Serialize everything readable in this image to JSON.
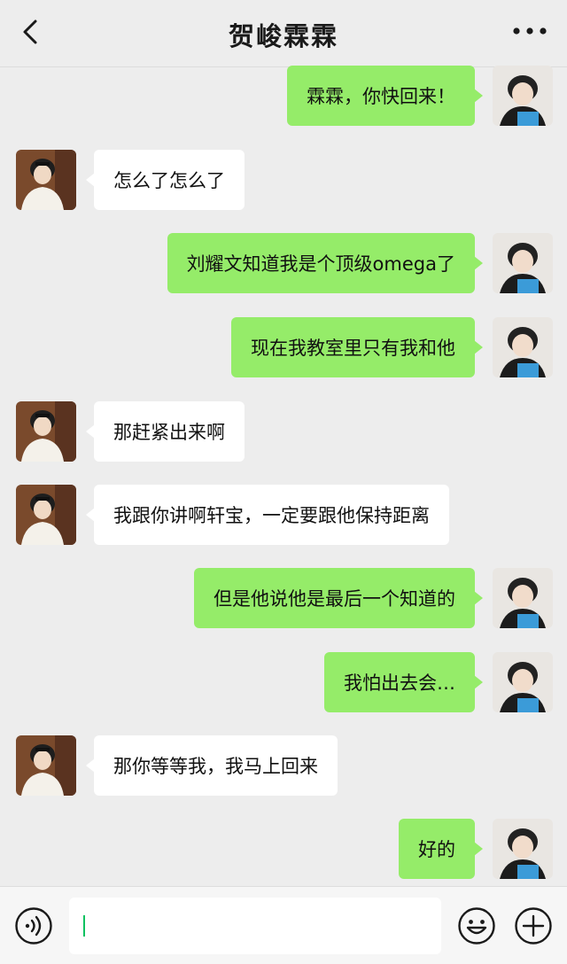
{
  "header": {
    "title": "贺峻霖霖",
    "back_icon": "chevron-left-icon",
    "more_icon": "more-dots-icon"
  },
  "messages": [
    {
      "side": "sent",
      "text": "霖霖，你快回来！"
    },
    {
      "side": "recv",
      "text": "怎么了怎么了"
    },
    {
      "side": "sent",
      "text": "刘耀文知道我是个顶级omega了"
    },
    {
      "side": "sent",
      "text": "现在我教室里只有我和他"
    },
    {
      "side": "recv",
      "text": "那赶紧出来啊"
    },
    {
      "side": "recv",
      "text": "我跟你讲啊轩宝，一定要跟他保持距离"
    },
    {
      "side": "sent",
      "text": "但是他说他是最后一个知道的"
    },
    {
      "side": "sent",
      "text": "我怕出去会…"
    },
    {
      "side": "recv",
      "text": "那你等等我，我马上回来"
    },
    {
      "side": "sent",
      "text": "好的"
    }
  ],
  "input": {
    "value": "",
    "voice_icon": "voice-icon",
    "emoji_icon": "emoji-icon",
    "plus_icon": "plus-icon"
  },
  "colors": {
    "background": "#ededed",
    "sent_bubble": "#95ec69",
    "recv_bubble": "#ffffff",
    "caret": "#07c160"
  }
}
